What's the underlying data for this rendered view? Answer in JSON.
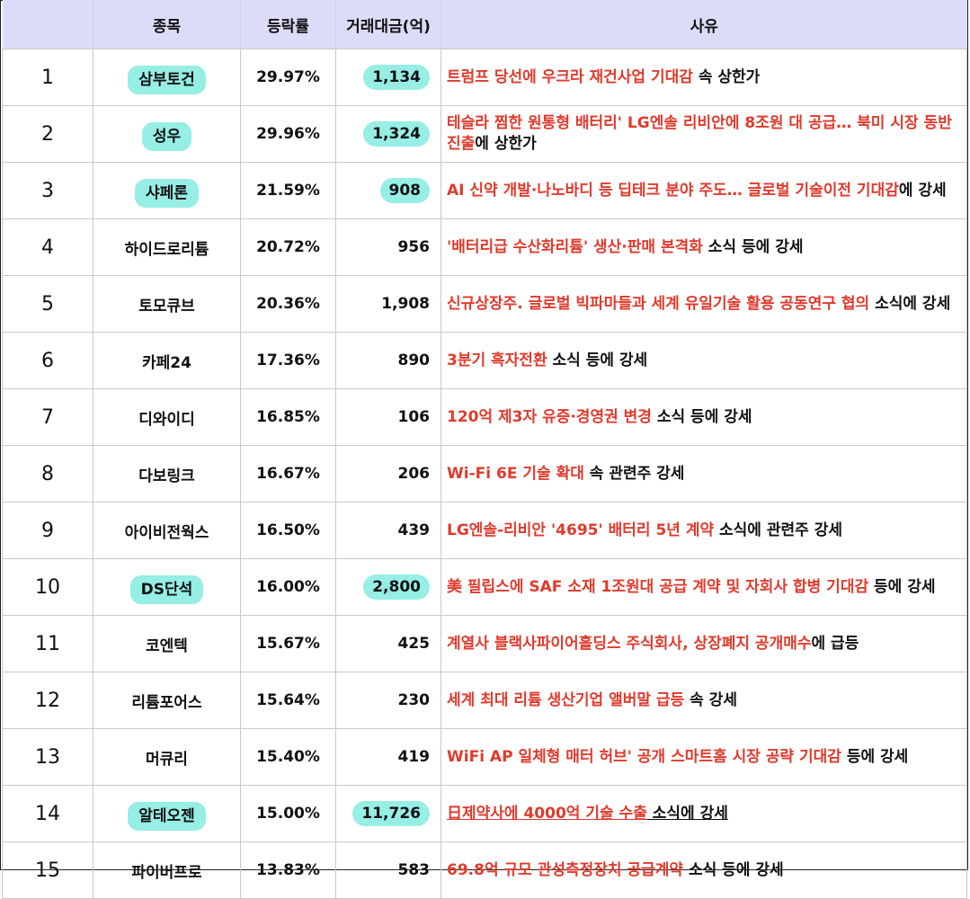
{
  "headers": {
    "rank": "",
    "name": "종목",
    "change": "등락률",
    "volume": "거래대금(억)",
    "reason": "사유"
  },
  "rows": [
    {
      "rank": "1",
      "name": "삼부토건",
      "change": "29.97%",
      "volume": "1,134",
      "reason_red": "트럼프 당선에 우크라 재건사업 기대감",
      "reason_black": " 속 상한가",
      "highlight": true
    },
    {
      "rank": "2",
      "name": "성우",
      "change": "29.96%",
      "volume": "1,324",
      "reason_red": "테슬라 찜한 원통형 배터리' LG엔솔 리비안에 8조원 대 공급… 북미 시장 동반 진출",
      "reason_black": "에 상한가",
      "highlight": true
    },
    {
      "rank": "3",
      "name": "샤페론",
      "change": "21.59%",
      "volume": "908",
      "reason_red": "AI 신약 개발·나노바디 등 딥테크 분야 주도… 글로벌 기술이전 기대감",
      "reason_black": "에 강세",
      "highlight": true
    },
    {
      "rank": "4",
      "name": "하이드로리튬",
      "change": "20.72%",
      "volume": "956",
      "reason_red": "'배터리급 수산화리튬' 생산·판매 본격화",
      "reason_black": " 소식 등에 강세",
      "highlight": false
    },
    {
      "rank": "5",
      "name": "토모큐브",
      "change": "20.36%",
      "volume": "1,908",
      "reason_red": "신규상장주. 글로벌 빅파마들과 세계 유일기술 활용 공동연구 협의",
      "reason_black": " 소식에 강세",
      "highlight": false
    },
    {
      "rank": "6",
      "name": "카페24",
      "change": "17.36%",
      "volume": "890",
      "reason_red": "3분기 흑자전환",
      "reason_black": " 소식 등에 강세",
      "highlight": false
    },
    {
      "rank": "7",
      "name": "디와이디",
      "change": "16.85%",
      "volume": "106",
      "reason_red": "120억 제3자 유증·경영권 변경",
      "reason_black": " 소식 등에 강세",
      "highlight": false
    },
    {
      "rank": "8",
      "name": "다보링크",
      "change": "16.67%",
      "volume": "206",
      "reason_red": "Wi-Fi 6E 기술 확대",
      "reason_black": " 속 관련주 강세",
      "highlight": false
    },
    {
      "rank": "9",
      "name": "아이비전웍스",
      "change": "16.50%",
      "volume": "439",
      "reason_red": "LG엔솔-리비안 '4695' 배터리 5년 계약",
      "reason_black": " 소식에 관련주 강세",
      "highlight": false
    },
    {
      "rank": "10",
      "name": "DS단석",
      "change": "16.00%",
      "volume": "2,800",
      "reason_red": "美 필립스에 SAF 소재 1조원대 공급 계약 및 자회사 합병 기대감",
      "reason_black": " 등에 강세",
      "highlight": true
    },
    {
      "rank": "11",
      "name": "코엔텍",
      "change": "15.67%",
      "volume": "425",
      "reason_red": "계열사 블랙사파이어홀딩스 주식회사, 상장폐지 공개매수",
      "reason_black": "에 급등",
      "highlight": false
    },
    {
      "rank": "12",
      "name": "리튬포어스",
      "change": "15.64%",
      "volume": "230",
      "reason_red": "세계 최대 리튬 생산기업 앨버말 급등",
      "reason_black": " 속 강세",
      "highlight": false
    },
    {
      "rank": "13",
      "name": "머큐리",
      "change": "15.40%",
      "volume": "419",
      "reason_red": "WiFi AP 일체형 매터 허브' 공개 스마트홈 시장 공략 기대감",
      "reason_black": " 등에 강세",
      "highlight": false
    },
    {
      "rank": "14",
      "name": "알테오젠",
      "change": "15.00%",
      "volume": "11,726",
      "reason_red": "日제약사에 4000억 기술 수출",
      "reason_black": " 소식에 강세",
      "highlight": true,
      "underline": true
    },
    {
      "rank": "15",
      "name": "파이버프로",
      "change": "13.83%",
      "volume": "583",
      "reason_red": "69.8억 규모 관성측정장치 공급계약",
      "reason_black": " 소식 등에 강세",
      "highlight": false
    }
  ],
  "colors": {
    "header_bg": "#dcdcf8",
    "reason_red": "#e03a2c",
    "highlight": "#40e0d0"
  }
}
